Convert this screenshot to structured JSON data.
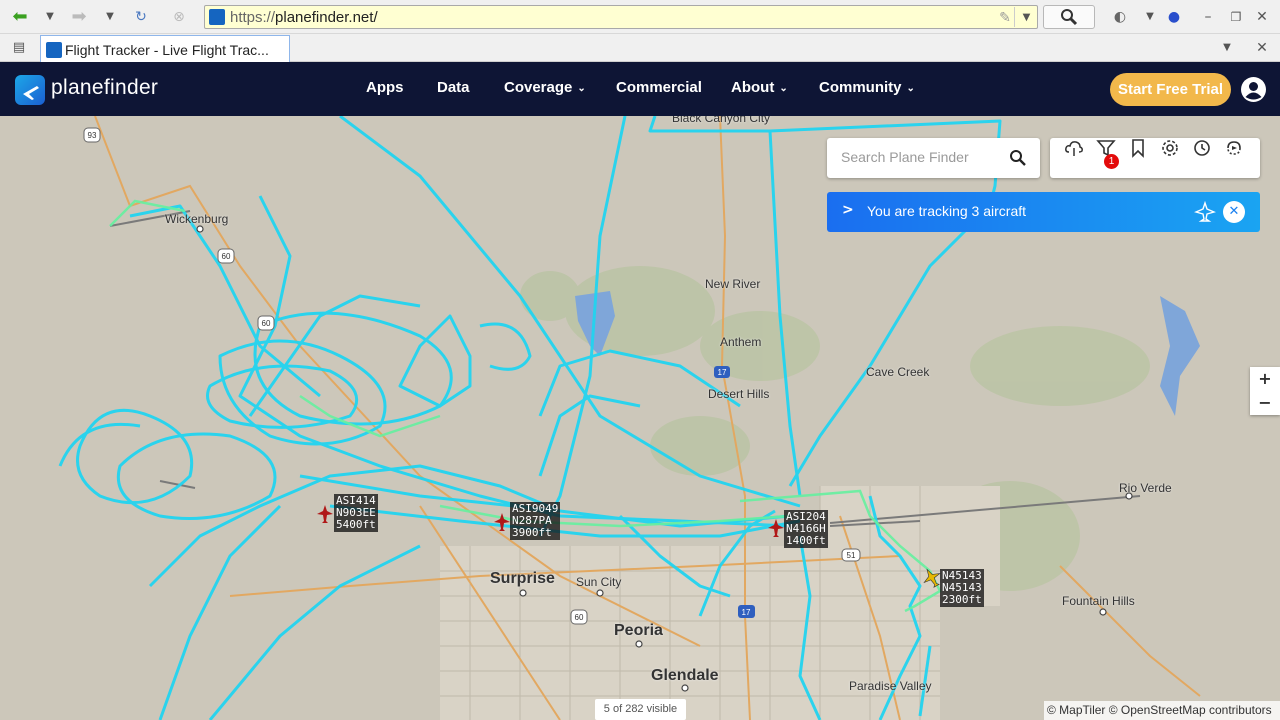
{
  "browser": {
    "url_protocol": "https://",
    "url_host": "planefinder.net/",
    "tab_title": "Flight Tracker - Live Flight Trac..."
  },
  "header": {
    "brand": "planefinder",
    "nav": [
      {
        "label": "Apps",
        "has_menu": false
      },
      {
        "label": "Data",
        "has_menu": false
      },
      {
        "label": "Coverage",
        "has_menu": true
      },
      {
        "label": "Commercial",
        "has_menu": false
      },
      {
        "label": "About",
        "has_menu": true
      },
      {
        "label": "Community",
        "has_menu": true
      }
    ],
    "cta_label": "Start Free Trial"
  },
  "search": {
    "placeholder": "Search Plane Finder"
  },
  "toolbar": {
    "notification_count": "1"
  },
  "tracking_banner": {
    "text": "You are tracking 3 aircraft"
  },
  "zoom": {
    "in": "+",
    "out": "−"
  },
  "places": [
    {
      "name": "Wickenburg",
      "size": "small"
    },
    {
      "name": "New River",
      "size": "small"
    },
    {
      "name": "Anthem",
      "size": "small"
    },
    {
      "name": "Cave Creek",
      "size": "small"
    },
    {
      "name": "Desert Hills",
      "size": "small"
    },
    {
      "name": "Rio Verde",
      "size": "small"
    },
    {
      "name": "Black Canyon City",
      "size": "small"
    },
    {
      "name": "Surprise",
      "size": "big"
    },
    {
      "name": "Sun City",
      "size": "small"
    },
    {
      "name": "Peoria",
      "size": "big"
    },
    {
      "name": "Glendale",
      "size": "big"
    },
    {
      "name": "Fountain Hills",
      "size": "small"
    },
    {
      "name": "Paradise Valley",
      "size": "small"
    }
  ],
  "aircraft": [
    {
      "callsign": "ASI414",
      "registration": "N903EE",
      "altitude": "5400ft",
      "color": "#b01818"
    },
    {
      "callsign": "ASI9049",
      "registration": "N287PA",
      "altitude": "3900ft",
      "color": "#b01818"
    },
    {
      "callsign": "ASI204",
      "registration": "N4166H",
      "altitude": "1400ft",
      "color": "#b01818"
    },
    {
      "callsign": "N45143",
      "registration": "N45143",
      "altitude": "2300ft",
      "color": "#e6b800"
    }
  ],
  "map_footer": {
    "visible_count": "5 of 282 visible",
    "attribution": "© MapTiler © OpenStreetMap contributors"
  },
  "colors": {
    "nav_bg": "#0e1535",
    "track_primary": "#22d4f0",
    "track_secondary": "#66f0a0",
    "cta": "#f2b84b",
    "banner": "#1a8cf0"
  }
}
